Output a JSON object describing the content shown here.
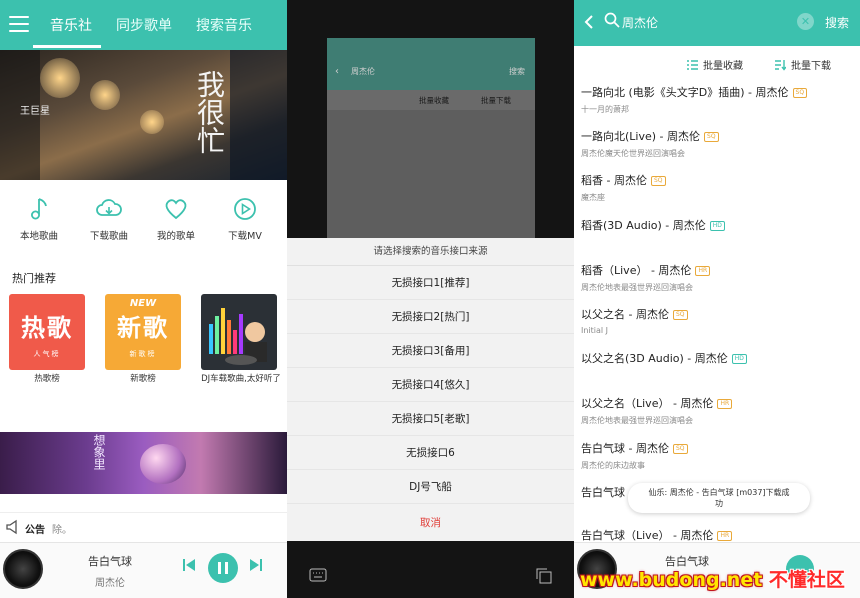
{
  "panel1": {
    "tabs": [
      "音乐社",
      "同步歌单",
      "搜索音乐"
    ],
    "banner": {
      "title": "我很忙",
      "artist": "王巨星"
    },
    "quick_actions": [
      {
        "label": "本地歌曲",
        "icon": "music-note-icon"
      },
      {
        "label": "下载歌曲",
        "icon": "cloud-download-icon"
      },
      {
        "label": "我的歌单",
        "icon": "heart-icon"
      },
      {
        "label": "下载MV",
        "icon": "play-circle-icon"
      }
    ],
    "hot_title": "热门推荐",
    "hot_cards": [
      {
        "big": "热歌",
        "small": "人气榜",
        "caption": "热歌榜",
        "color": "#f05a4a"
      },
      {
        "tag": "NEW",
        "big": "新歌",
        "small": "新歌榜",
        "caption": "新歌榜",
        "color": "#f6a936"
      },
      {
        "caption": "DJ车载歌曲,太好听了"
      }
    ],
    "banner2_text": "想象里",
    "notice_label": "公告",
    "notice_text": "除。",
    "player": {
      "song": "告白气球",
      "singer": "周杰伦"
    }
  },
  "panel2": {
    "dim_query": "周杰伦",
    "dim_search": "搜索",
    "dim_batch_collect": "批量收藏",
    "dim_batch_download": "批量下载",
    "sheet_title": "请选择搜索的音乐接口来源",
    "options": [
      "无损接口1[推荐]",
      "无损接口2[热门]",
      "无损接口3[备用]",
      "无损接口4[悠久]",
      "无损接口5[老歌]",
      "无损接口6",
      "DJ号飞船"
    ],
    "cancel": "取消"
  },
  "panel3": {
    "query": "周杰伦",
    "search_btn": "搜索",
    "batch_collect": "批量收藏",
    "batch_download": "批量下载",
    "results": [
      {
        "title": "一路向北 (电影《头文字D》插曲) - 周杰伦",
        "badge": "SQ",
        "album": "十一月的萧邦"
      },
      {
        "title": "一路向北(Live) - 周杰伦",
        "badge": "SQ",
        "album": "周杰伦魔天伦世界巡回演唱会"
      },
      {
        "title": "稻香 - 周杰伦",
        "badge": "SQ",
        "album": "魔杰座"
      },
      {
        "title": "稻香(3D Audio) - 周杰伦",
        "badge": "HD",
        "album": ""
      },
      {
        "title": "稻香（Live） - 周杰伦",
        "badge": "HR",
        "album": "周杰伦地表最强世界巡回演唱会"
      },
      {
        "title": "以父之名 - 周杰伦",
        "badge": "SQ",
        "album": "Initial J"
      },
      {
        "title": "以父之名(3D Audio) - 周杰伦",
        "badge": "HD",
        "album": ""
      },
      {
        "title": "以父之名（Live） - 周杰伦",
        "badge": "HR",
        "album": "周杰伦地表最强世界巡回演唱会"
      },
      {
        "title": "告白气球 - 周杰伦",
        "badge": "SQ",
        "album": "周杰伦的床边故事"
      },
      {
        "title": "告白气球",
        "badge": "",
        "album": ""
      },
      {
        "title": "告白气球（Live） - 周杰伦",
        "badge": "HR",
        "album": ""
      }
    ],
    "toast_line1": "仙乐: 周杰伦 - 告白气球 [m037]下载成",
    "toast_line2": "功",
    "player_song": "告白气球"
  },
  "watermark": {
    "url": "www.budong.net",
    "cn": "不懂社区"
  },
  "colors": {
    "accent": "#3cc1ae",
    "cancel": "#e03b35",
    "badge_sq": "#e9a93a",
    "badge_hd": "#3cc1ae"
  }
}
